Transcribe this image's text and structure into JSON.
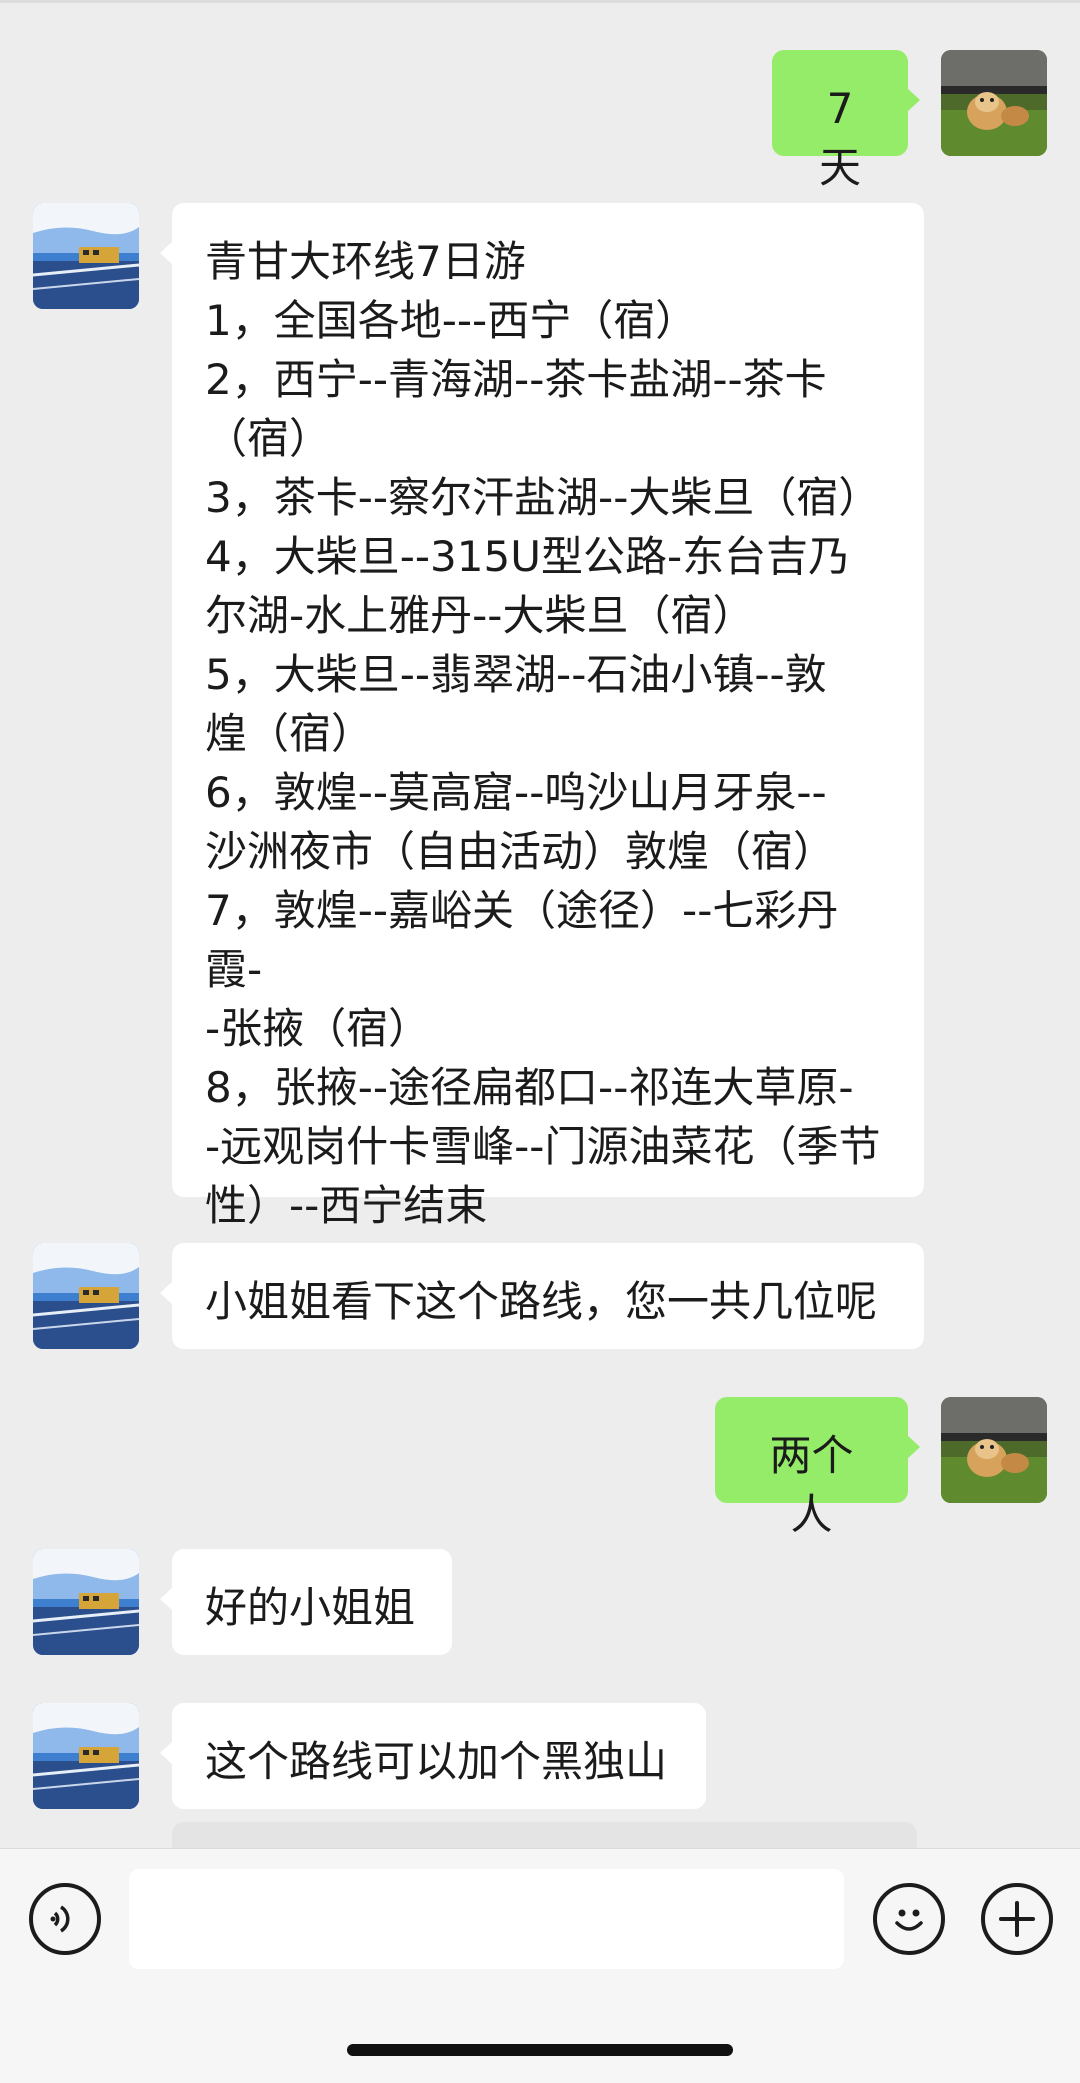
{
  "messages": [
    {
      "side": "out",
      "text": "7天",
      "avatar_icon": "dog-photo-avatar-icon"
    },
    {
      "side": "in",
      "text": "青甘大环线7日游\n1，全国各地---西宁（宿）\n2，西宁--青海湖--茶卡盐湖--茶卡\n（宿）\n3，茶卡--察尔汗盐湖--大柴旦（宿）\n4，大柴旦--315U型公路-东台吉乃\n尔湖-水上雅丹--大柴旦（宿）\n5，大柴旦--翡翠湖--石油小镇--敦\n煌（宿）\n6，敦煌--莫高窟--鸣沙山月牙泉--\n沙洲夜市（自由活动）敦煌（宿）\n7，敦煌--嘉峪关（途径）--七彩丹霞-\n-张掖（宿）\n8，张掖--途径扁都口--祁连大草原-\n-远观岗什卡雪峰--门源油菜花（季节\n性）--西宁结束",
      "avatar_icon": "train-photo-avatar-icon"
    },
    {
      "side": "in",
      "text": "小姐姐看下这个路线，您一共几位呢",
      "avatar_icon": "train-photo-avatar-icon"
    },
    {
      "side": "out",
      "text": "两个人",
      "avatar_icon": "dog-photo-avatar-icon"
    },
    {
      "side": "in",
      "text": "好的小姐姐",
      "avatar_icon": "train-photo-avatar-icon"
    },
    {
      "side": "in",
      "text": "这个路线可以加个黑独山",
      "avatar_icon": "train-photo-avatar-icon"
    }
  ],
  "input_bar": {
    "voice_icon": "voice-icon",
    "input_value": "",
    "emoji_icon": "emoji-icon",
    "add_icon": "plus-icon"
  },
  "colors": {
    "background": "#ededed",
    "outgoing_bubble": "#95ec69",
    "incoming_bubble": "#ffffff"
  }
}
